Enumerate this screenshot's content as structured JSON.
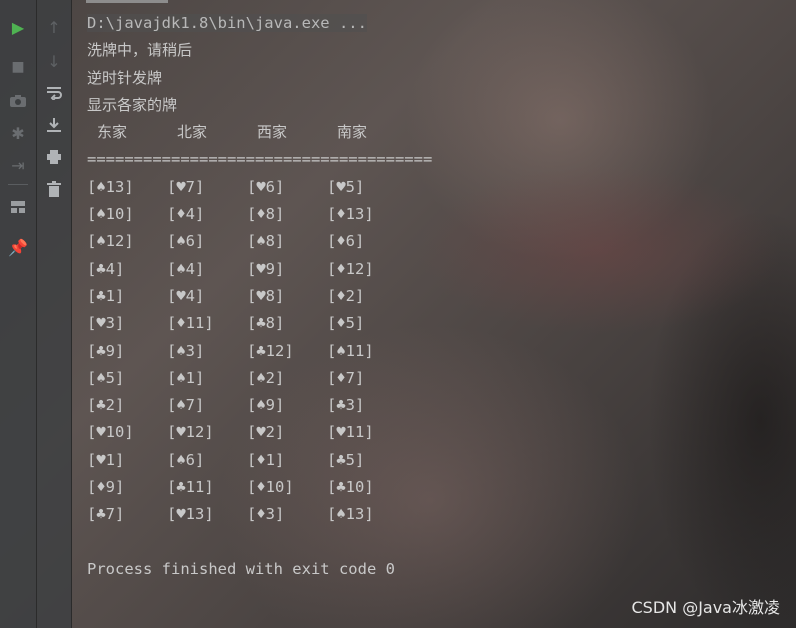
{
  "toolbar": {
    "run_icon": "play-icon",
    "stop_icon": "stop-icon",
    "camera_icon": "camera-icon",
    "debug_icon": "bug-icon",
    "login_icon": "sign-in-icon",
    "layout_icon": "layout-icon",
    "pin_icon": "pin-icon",
    "up_icon": "arrow-up-icon",
    "down_icon": "arrow-down-icon",
    "wrap_icon": "soft-wrap-icon",
    "scroll_end_icon": "scroll-to-end-icon",
    "print_icon": "print-icon",
    "trash_icon": "trash-icon"
  },
  "console": {
    "command": "D:\\javajdk1.8\\bin\\java.exe ...",
    "line1": "洗牌中，请稍后",
    "line2": "逆时针发牌",
    "line3": "显示各家的牌",
    "headers": [
      "东家",
      "北家",
      "西家",
      "南家"
    ],
    "separator": "=====================================",
    "rows": [
      [
        "[♠13]",
        "[♥7]",
        "[♥6]",
        "[♥5]"
      ],
      [
        "[♠10]",
        "[♦4]",
        "[♦8]",
        "[♦13]"
      ],
      [
        "[♠12]",
        "[♠6]",
        "[♠8]",
        "[♦6]"
      ],
      [
        "[♣4]",
        "[♠4]",
        "[♥9]",
        "[♦12]"
      ],
      [
        "[♣1]",
        "[♥4]",
        "[♥8]",
        "[♦2]"
      ],
      [
        "[♥3]",
        "[♦11]",
        "[♣8]",
        "[♦5]"
      ],
      [
        "[♣9]",
        "[♠3]",
        "[♣12]",
        "[♠11]"
      ],
      [
        "[♠5]",
        "[♠1]",
        "[♠2]",
        "[♦7]"
      ],
      [
        "[♣2]",
        "[♠7]",
        "[♠9]",
        "[♣3]"
      ],
      [
        "[♥10]",
        "[♥12]",
        "[♥2]",
        "[♥11]"
      ],
      [
        "[♥1]",
        "[♠6]",
        "[♦1]",
        "[♣5]"
      ],
      [
        "[♦9]",
        "[♣11]",
        "[♦10]",
        "[♣10]"
      ],
      [
        "[♣7]",
        "[♥13]",
        "[♦3]",
        "[♠13]"
      ]
    ],
    "exit_message": "Process finished with exit code 0"
  },
  "watermark": "CSDN @Java冰激凌",
  "colors": {
    "run_green": "#4fb352",
    "console_text": "#c8c8c8",
    "toolbar_bg": "#3c3f41"
  }
}
